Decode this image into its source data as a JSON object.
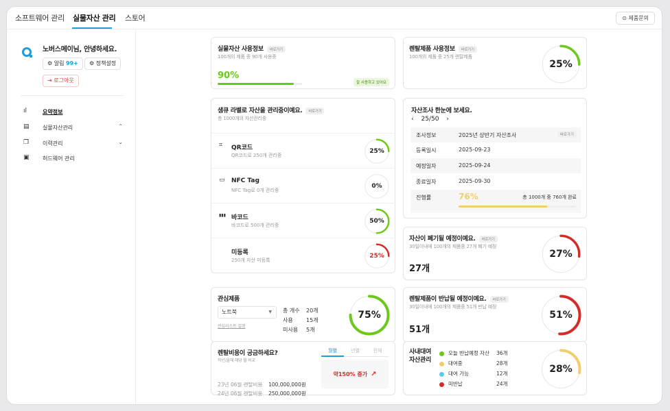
{
  "topnav": {
    "tabs": [
      "소프트웨어 관리",
      "실물자산 관리",
      "스토어"
    ],
    "inquiry": "제품문의"
  },
  "sidebar": {
    "greeting": "노버스메이님, 안녕하세요.",
    "alarm_label": "알림",
    "alarm_count": "99+",
    "policy_label": "정책설정",
    "logout_label": "로그아웃",
    "menu": [
      {
        "label": "요약정보",
        "active": true
      },
      {
        "label": "실물자산관리",
        "chevron": "⌃"
      },
      {
        "label": "이력관리",
        "chevron": "⌄"
      },
      {
        "label": "허드웨어 관리"
      }
    ]
  },
  "asset_usage": {
    "title": "실물자산 사용정보",
    "pill": "바로가기",
    "sub": "100개의 제품 중 90개 사용중",
    "percent": "90%",
    "progress": 0.9,
    "badge": "잘 사용하고 있어요"
  },
  "rental_usage": {
    "title": "렌탈제품 사용정보",
    "pill": "바로가기",
    "sub": "100개의 제품 중 25개 렌탈제품",
    "percent_label": "25%",
    "percent": 0.25
  },
  "label_mgmt": {
    "title": "샘큐 라벨로 자산을 관리중이예요.",
    "pill": "바로가기",
    "sub": "총 1000개의 자산관리중",
    "rows": [
      {
        "name": "QR코드",
        "sub": "QR코드로 250개 관리중",
        "percent_label": "25%",
        "percent": 0.25,
        "color": "#6cc919",
        "icon": "⌗"
      },
      {
        "name": "NFC Tag",
        "sub": "NFC Tag로 0개 관리중",
        "percent_label": "0%",
        "percent": 0,
        "color": "#6cc919",
        "icon": "▭"
      },
      {
        "name": "바코드",
        "sub": "바코드로 500개 관리중",
        "percent_label": "50%",
        "percent": 0.5,
        "color": "#6cc919",
        "icon": "▮▮▮"
      },
      {
        "name": "미등록",
        "sub": "250개 자산 미등록",
        "percent_label": "25%",
        "percent": 0.25,
        "color": "#d42b2b",
        "icon": ""
      }
    ]
  },
  "survey": {
    "title": "자산조사 한눈에 보세요.",
    "page": "25/50",
    "rows": [
      {
        "key": "조사정보",
        "value": "2025년 상반기 자산조사",
        "pill": "바로가기"
      },
      {
        "key": "등록일시",
        "value": "2025-09-23"
      },
      {
        "key": "예정일자",
        "value": "2025-09-24"
      },
      {
        "key": "종료일자",
        "value": "2025-09-30"
      }
    ],
    "progress_key": "진행률",
    "progress_value": "76%",
    "progress": 0.76,
    "progress_note": "총 1000개 중 760개 완료"
  },
  "disposal": {
    "title": "자산이 폐기될 예정이예요.",
    "pill": "바로가기",
    "sub": "30일이내에 100개의 제품중 27개 폐기 예정",
    "count": "27개",
    "percent_label": "27%",
    "percent": 0.27
  },
  "favorite": {
    "title": "관심제품",
    "select_value": "노트북",
    "link": "관심리스트 설정",
    "stats": [
      {
        "k": "총 개수",
        "v": "20개"
      },
      {
        "k": "사용",
        "v": "15개"
      },
      {
        "k": "미사용",
        "v": "5개"
      }
    ],
    "percent_label": "75%",
    "percent": 0.75
  },
  "rental_return": {
    "title": "렌탈제품이 반납될 예정이예요.",
    "pill": "바로가기",
    "sub": "30일이내에 100개의 제품중 51개 반납 예정",
    "count": "51개",
    "percent_label": "51%",
    "percent": 0.51
  },
  "rental_cost": {
    "title": "렌탈비용이 궁금하세요?",
    "sub": "작년/올해 해당 월 비교",
    "tabs": [
      "월별",
      "년별",
      "전체"
    ],
    "rows": [
      {
        "k": "23년 06월 렌탈비용",
        "v": "100,000,000원"
      },
      {
        "k": "24년 06월 렌탈비용",
        "v": "250,000,000원"
      }
    ],
    "increase": "약150% 증가",
    "trend_icon": "↗"
  },
  "internal_loan": {
    "title_line1": "사내대여",
    "title_line2": "자산관리",
    "legend": [
      {
        "label": "오늘 반납예정 자산",
        "value": "36개",
        "color": "#6cc919"
      },
      {
        "label": "대여중",
        "value": "28개",
        "color": "#f0cf6b"
      },
      {
        "label": "대여 가능",
        "value": "12개",
        "color": "#5bc9ee"
      },
      {
        "label": "미반납",
        "value": "24개",
        "color": "#d42b2b"
      }
    ],
    "percent_label": "28%",
    "percent": 0.28
  }
}
